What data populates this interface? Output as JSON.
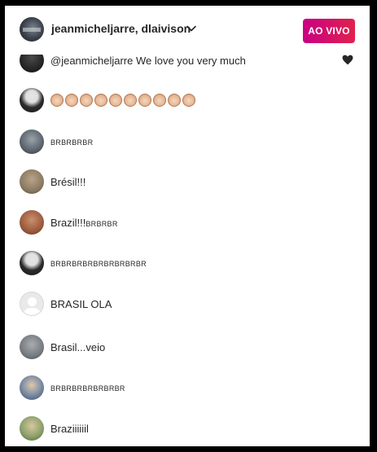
{
  "header": {
    "title": "jeanmicheljarre, dlaivison",
    "live_label": "AO VIVO"
  },
  "comments": [
    {
      "text": "@jeanmicheljarre We love you very much",
      "icon": "heart-icon"
    },
    {
      "text": "",
      "emoji": "clapping-hands x10"
    },
    {
      "text": "BRBRBRBR"
    },
    {
      "text": "Brésil!!!"
    },
    {
      "text_main": "Brazil!!!",
      "text_small": "BRBRBR"
    },
    {
      "text": "BRBRBRBRBRBRBRBRBR"
    },
    {
      "text": "BRASIL OLA"
    },
    {
      "text": "Brasil...veio"
    },
    {
      "text": "BRBRBRBRBRBRBR"
    },
    {
      "text": "Braziiiiiil"
    }
  ],
  "colors": {
    "live_gradient_start": "#c90083",
    "live_gradient_end": "#e0224c",
    "text": "#262626"
  }
}
